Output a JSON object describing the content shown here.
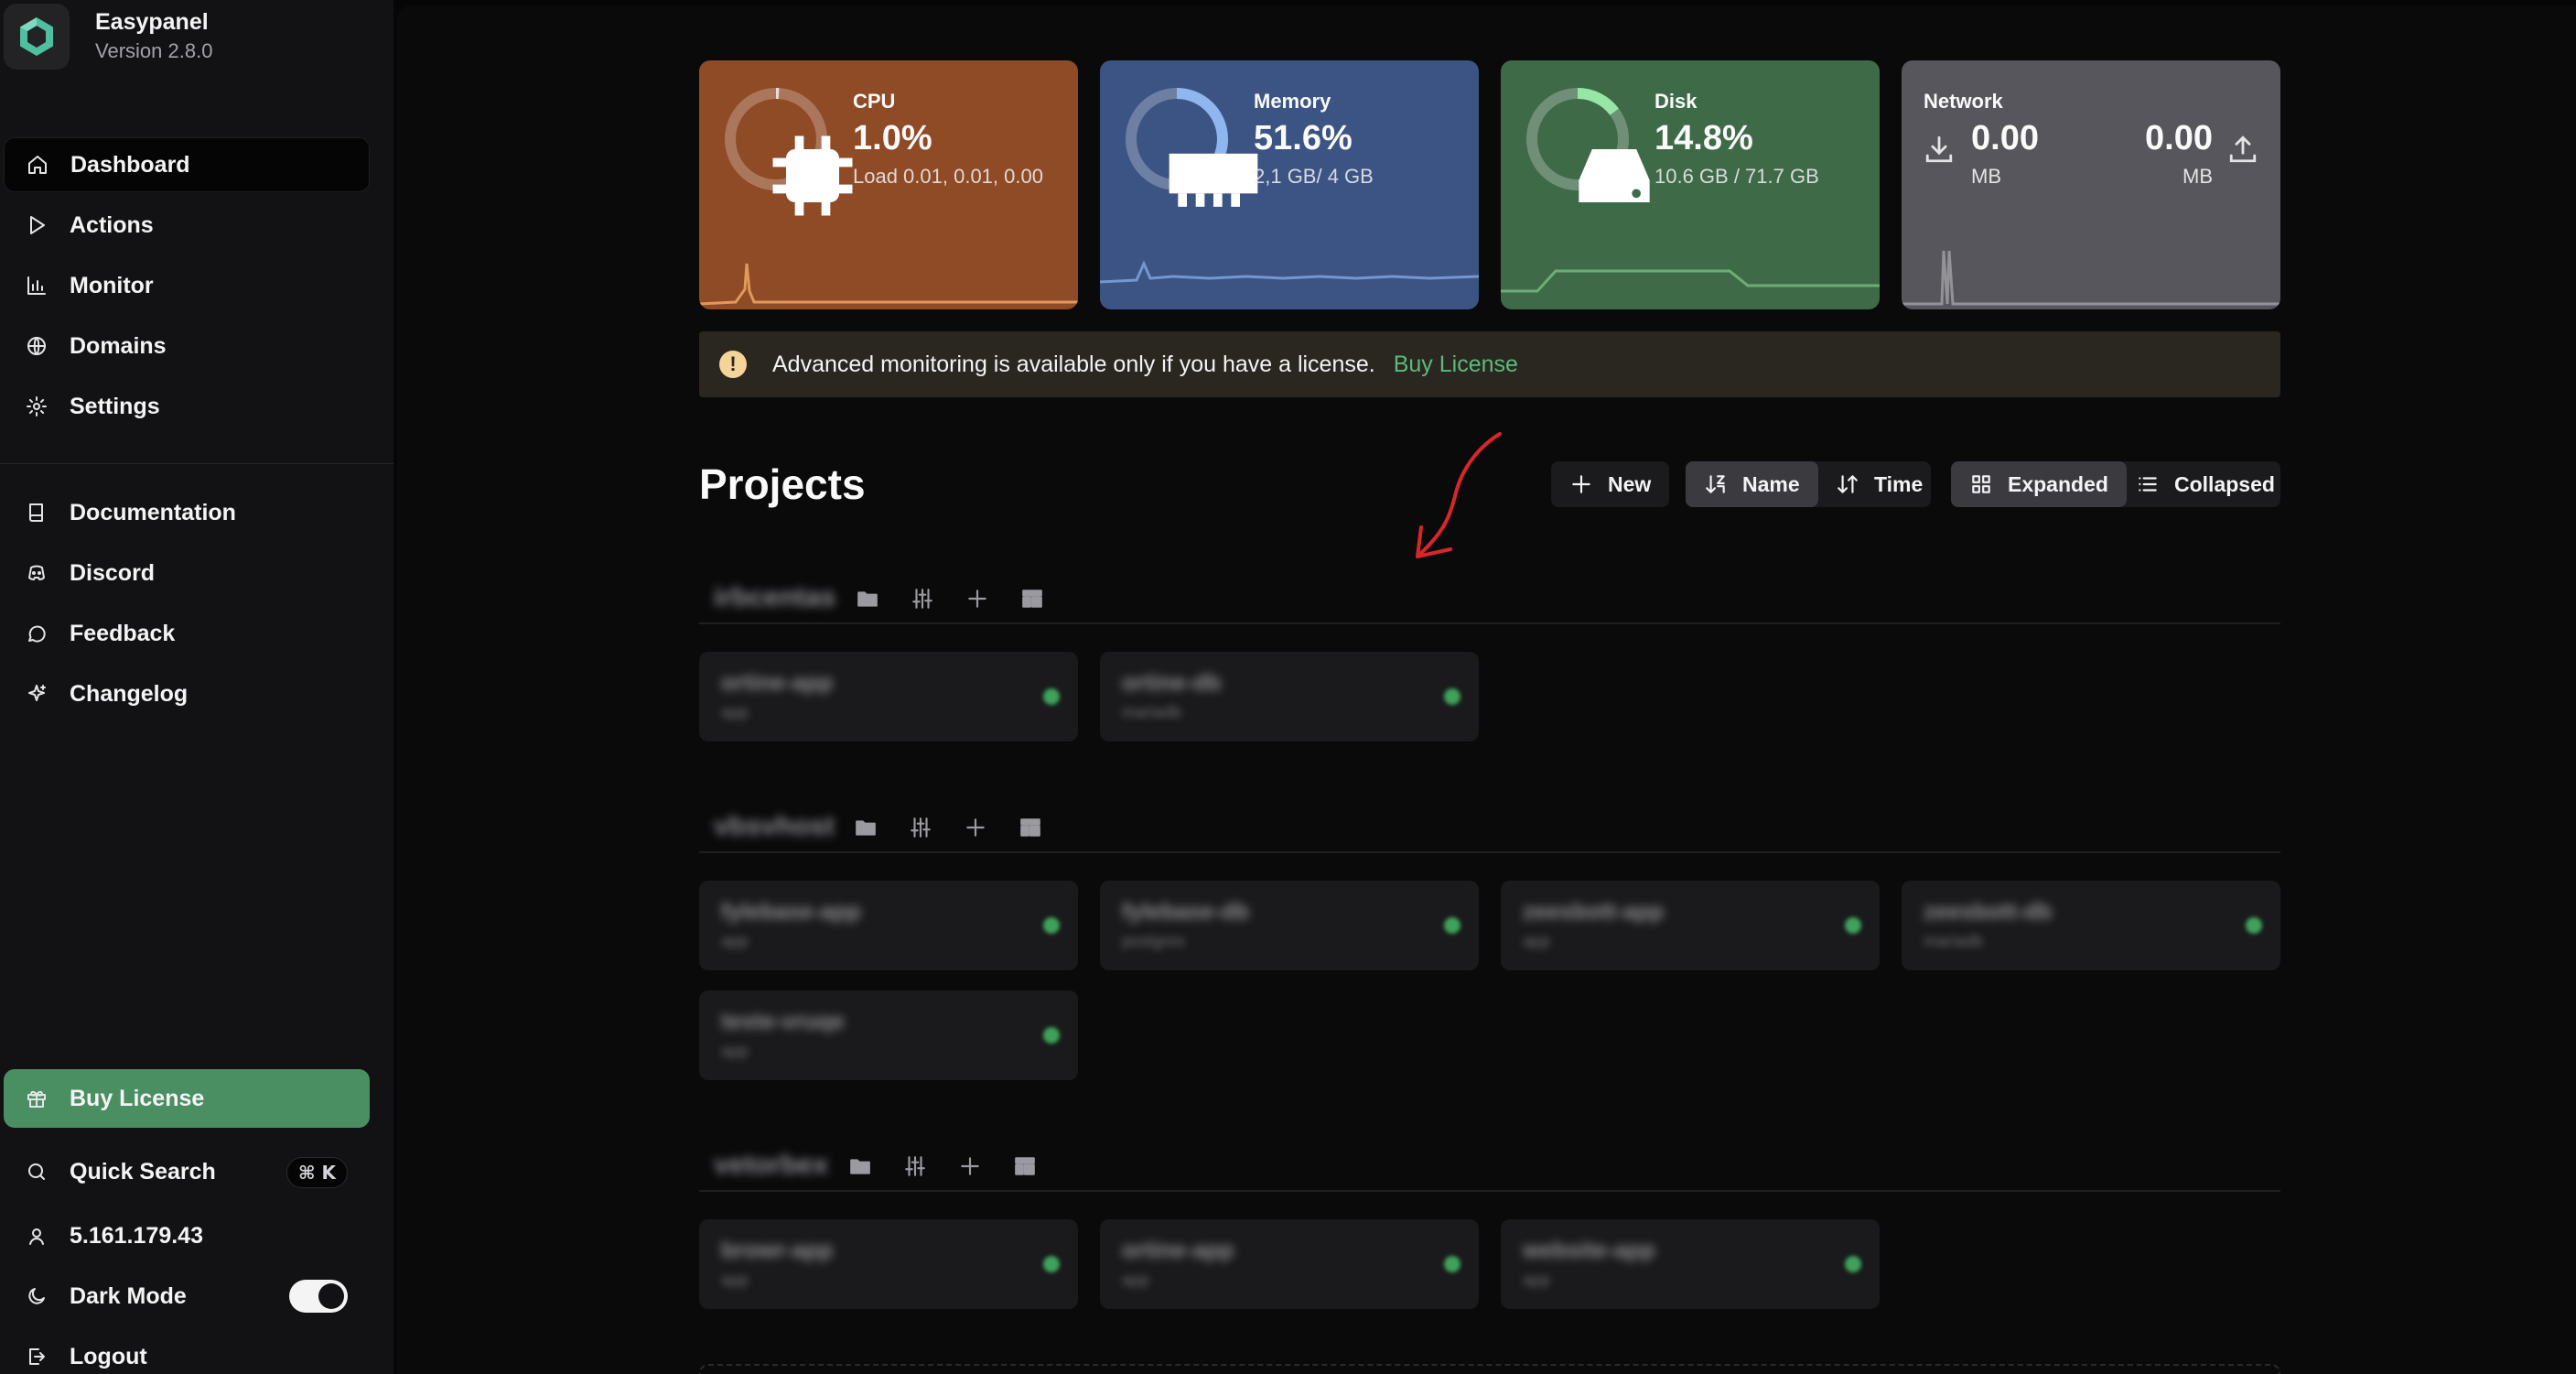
{
  "brand": {
    "name": "Easypanel",
    "version": "Version 2.8.0"
  },
  "nav": {
    "main": [
      {
        "label": "Dashboard",
        "icon": "home-icon",
        "active": true
      },
      {
        "label": "Actions",
        "icon": "play-icon"
      },
      {
        "label": "Monitor",
        "icon": "bar-chart-icon"
      },
      {
        "label": "Domains",
        "icon": "globe-icon"
      },
      {
        "label": "Settings",
        "icon": "gear-icon"
      }
    ],
    "resources": [
      {
        "label": "Documentation",
        "icon": "book-icon"
      },
      {
        "label": "Discord",
        "icon": "discord-icon"
      },
      {
        "label": "Feedback",
        "icon": "message-icon"
      },
      {
        "label": "Changelog",
        "icon": "sparkle-icon"
      }
    ]
  },
  "sidebar_bottom": {
    "buy_license": "Buy License",
    "quick_search": "Quick Search",
    "quick_search_kbd": "⌘ K",
    "ip": "5.161.179.43",
    "dark_mode": "Dark Mode",
    "dark_mode_on": true,
    "logout": "Logout"
  },
  "stats": {
    "cpu": {
      "label": "CPU",
      "value": "1.0%",
      "sub": "Load 0.01, 0.01, 0.00",
      "percent": 1.0,
      "color": "#8f4a26"
    },
    "memory": {
      "label": "Memory",
      "value": "51.6%",
      "sub": "2,1 GB/ 4 GB",
      "percent": 51.6,
      "color": "#3c5484"
    },
    "disk": {
      "label": "Disk",
      "value": "14.8%",
      "sub": "10.6 GB / 71.7 GB",
      "percent": 14.8,
      "color": "#3f6a48"
    },
    "network": {
      "label": "Network",
      "in_value": "0.00",
      "in_unit": "MB",
      "out_value": "0.00",
      "out_unit": "MB",
      "color": "#56565c"
    }
  },
  "alert": {
    "text": "Advanced monitoring is available only if you have a license.",
    "link": "Buy License"
  },
  "projects": {
    "title": "Projects",
    "new_button": "New",
    "sort": {
      "name": "Name",
      "time": "Time",
      "selected": "Name"
    },
    "view": {
      "expanded": "Expanded",
      "collapsed": "Collapsed",
      "selected": "Expanded"
    },
    "groups": [
      {
        "name": "irbcentas",
        "services": [
          {
            "name": "ortine-app",
            "type": "app"
          },
          {
            "name": "ortine-db",
            "type": "mariadb"
          }
        ]
      },
      {
        "name": "vbsvhost",
        "services": [
          {
            "name": "fylebase-app",
            "type": "app"
          },
          {
            "name": "fylebase-db",
            "type": "postgres"
          },
          {
            "name": "zeesbott-app",
            "type": "app"
          },
          {
            "name": "zeesbott-db",
            "type": "mariadb"
          },
          {
            "name": "teste-vruqe",
            "type": "app"
          }
        ]
      },
      {
        "name": "vetorbex",
        "services": [
          {
            "name": "browr-app",
            "type": "app"
          },
          {
            "name": "ortine-app",
            "type": "app"
          },
          {
            "name": "website-app",
            "type": "app"
          }
        ]
      }
    ]
  },
  "colors": {
    "accent_green": "#4a8f62",
    "link_green": "#5fb97a",
    "status_running": "#3fa25a",
    "annotation_red": "#d9262b"
  }
}
